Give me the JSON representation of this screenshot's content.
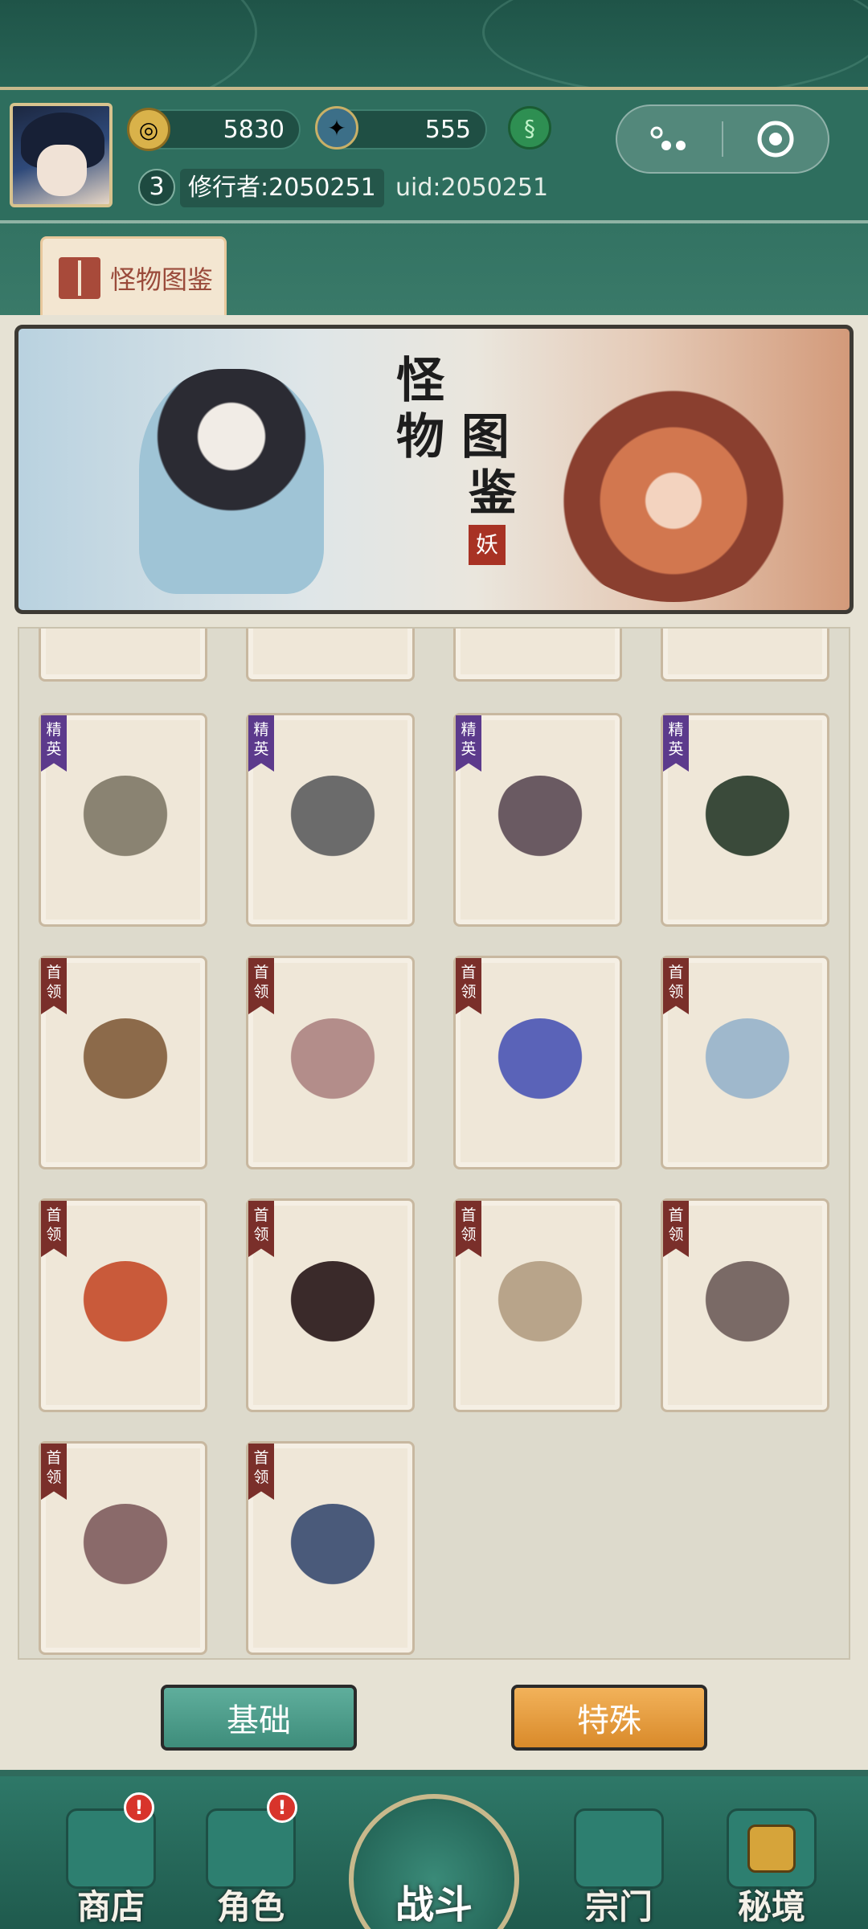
{
  "header": {
    "gold": "5830",
    "gem": "555",
    "level": "3",
    "username": "修行者:2050251",
    "uid": "uid:2050251"
  },
  "tab": {
    "label": "怪物图鉴"
  },
  "banner": {
    "title_line1": "怪",
    "title_line2": "物 图",
    "title_line3": "鉴",
    "stamp": "妖"
  },
  "cards": [
    {
      "tag": "精英",
      "type": "elite",
      "color": "#8a8372"
    },
    {
      "tag": "精英",
      "type": "elite",
      "color": "#6b6b6b"
    },
    {
      "tag": "精英",
      "type": "elite",
      "color": "#6a5a62"
    },
    {
      "tag": "精英",
      "type": "elite",
      "color": "#3a4a3a"
    },
    {
      "tag": "首领",
      "type": "boss",
      "color": "#8c6a4a"
    },
    {
      "tag": "首领",
      "type": "boss",
      "color": "#b38d8a"
    },
    {
      "tag": "首领",
      "type": "boss",
      "color": "#5a63b8"
    },
    {
      "tag": "首领",
      "type": "boss",
      "color": "#9fb8cc"
    },
    {
      "tag": "首领",
      "type": "boss",
      "color": "#c95a3a"
    },
    {
      "tag": "首领",
      "type": "boss",
      "color": "#3a2a2a"
    },
    {
      "tag": "首领",
      "type": "boss",
      "color": "#b8a48a"
    },
    {
      "tag": "首领",
      "type": "boss",
      "color": "#7a6a66"
    },
    {
      "tag": "首领",
      "type": "boss",
      "color": "#8a6a6a"
    },
    {
      "tag": "首领",
      "type": "boss",
      "color": "#4a5a7a"
    }
  ],
  "buttons": {
    "basic": "基础",
    "special": "特殊"
  },
  "nav": {
    "shop": "商店",
    "role": "角色",
    "battle": "战斗",
    "sect": "宗门",
    "realm": "秘境",
    "badge": "!"
  }
}
